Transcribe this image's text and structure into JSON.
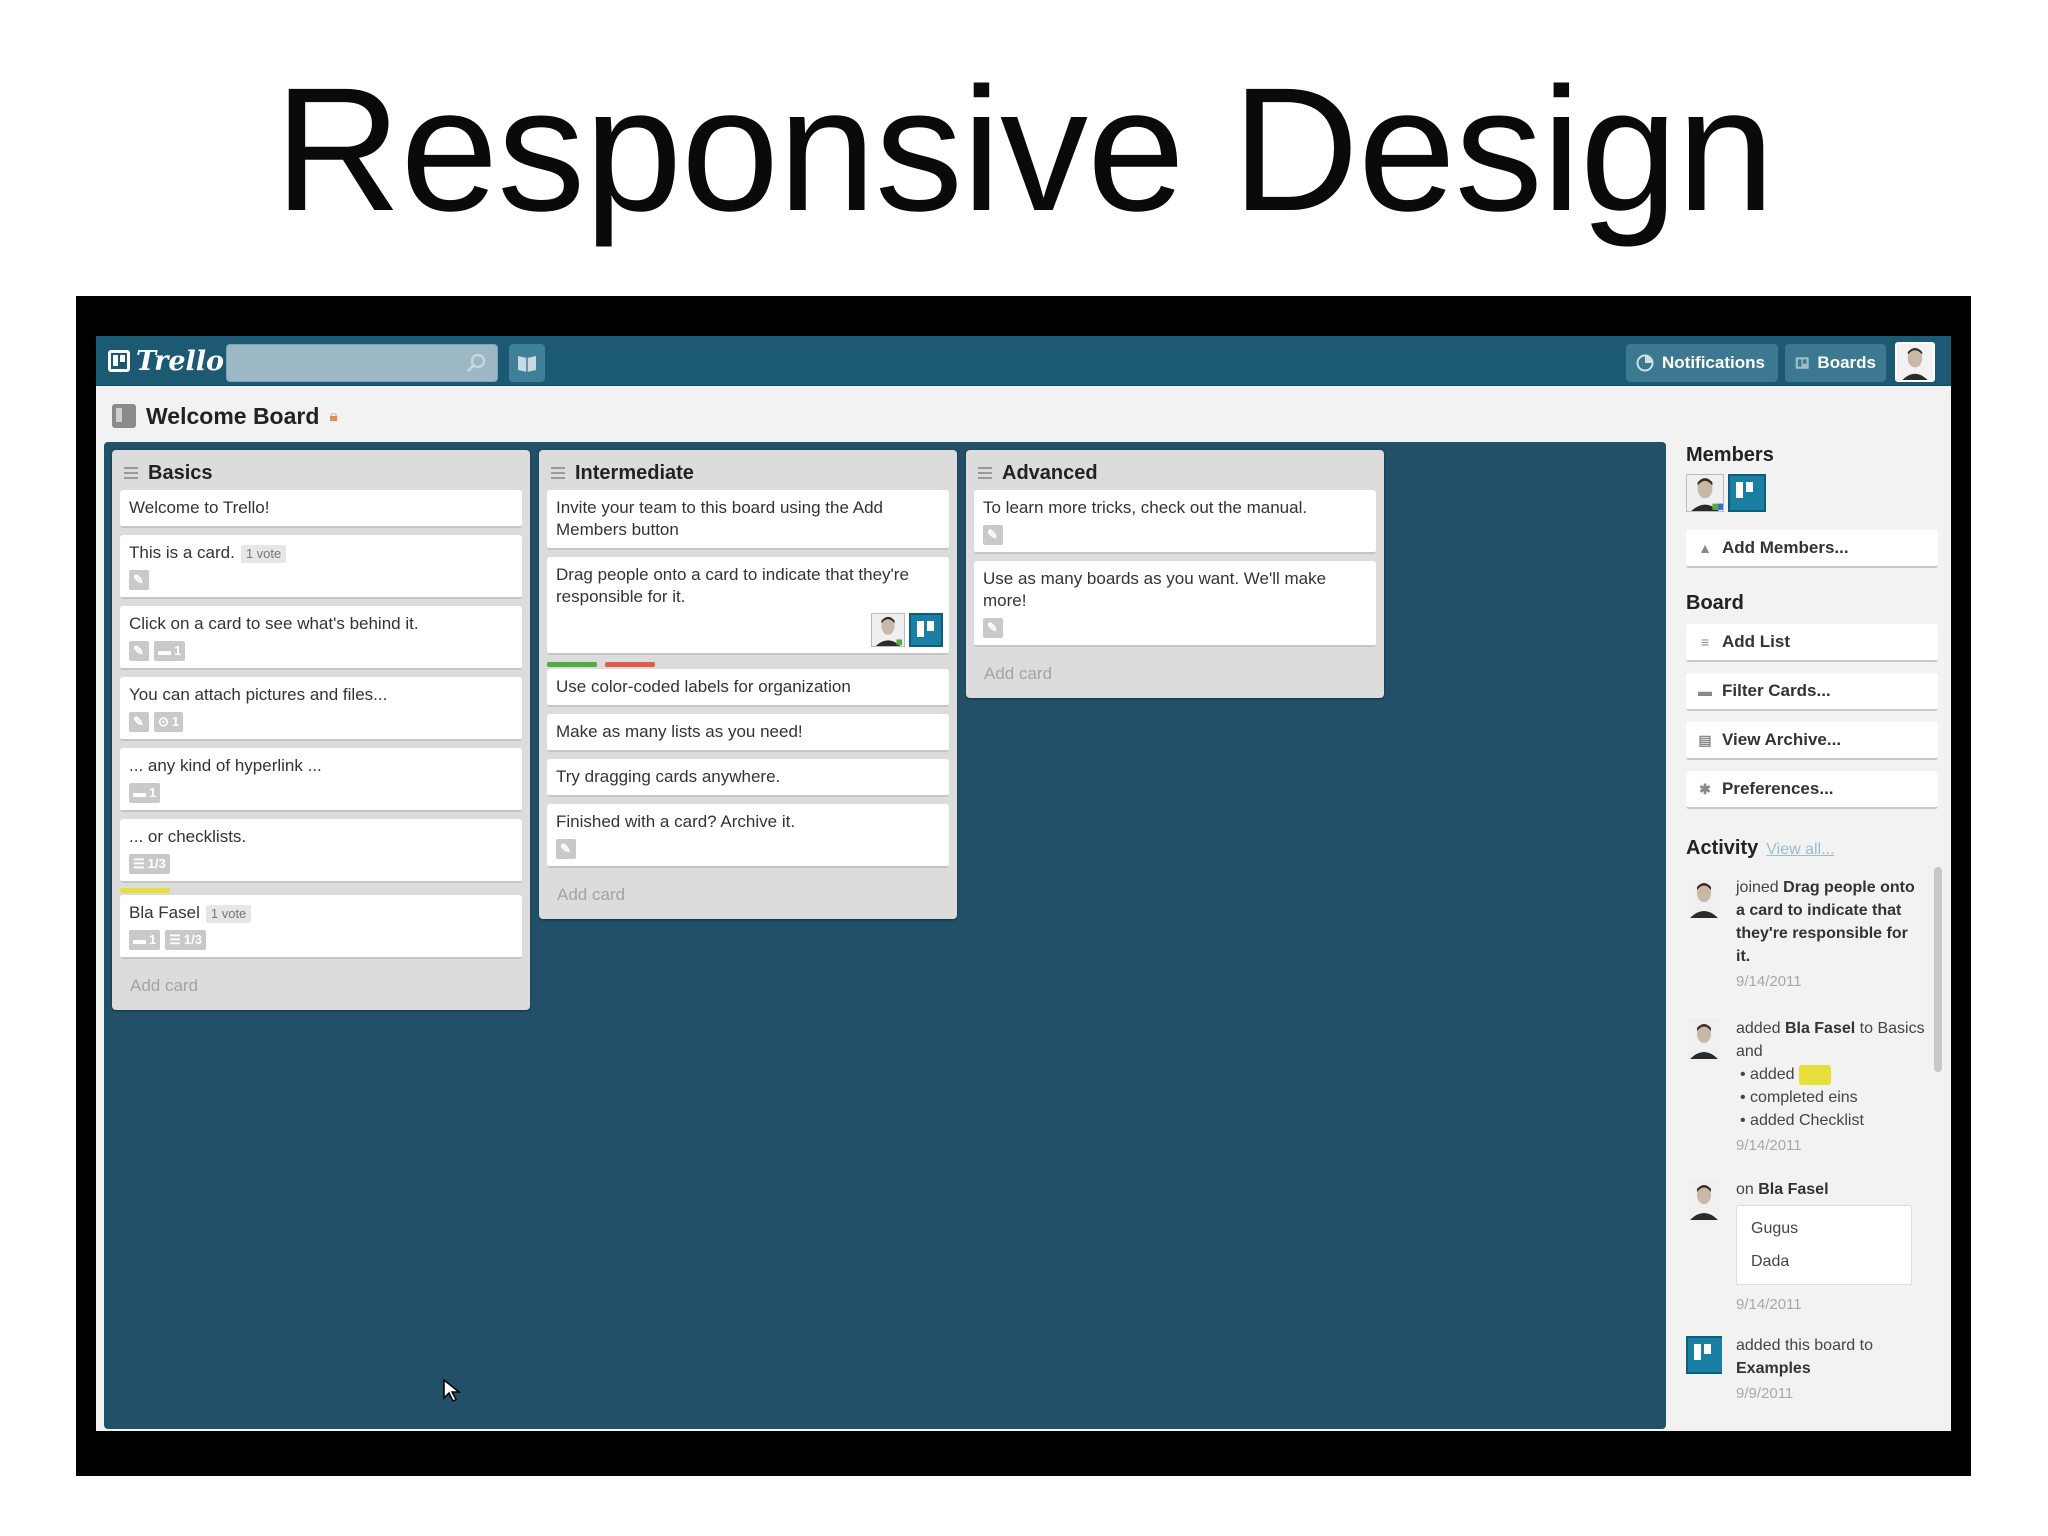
{
  "slide": {
    "title": "Responsive Design"
  },
  "app": {
    "logo_text": "Trello",
    "nav": {
      "notifications": "Notifications",
      "boards": "Boards"
    },
    "board_title": "Welcome Board",
    "accent": "#1c5a73",
    "board_bg": "#215068"
  },
  "lists": [
    {
      "title": "Basics",
      "cards": [
        {
          "text": "Welcome to Trello!"
        },
        {
          "text": "This is a card.",
          "vote": "1 vote",
          "badges": [
            "edit"
          ]
        },
        {
          "text": "Click on a card to see what's behind it.",
          "badges": [
            "edit",
            "comment:1"
          ]
        },
        {
          "text": "You can attach pictures and files...",
          "badges": [
            "edit",
            "attach:1"
          ]
        },
        {
          "text": "... any kind of hyperlink ...",
          "badges": [
            "comment:1"
          ]
        },
        {
          "text": "... or checklists.",
          "badges": [
            "check:1/3"
          ]
        },
        {
          "text": "Bla Fasel",
          "vote": "1 vote",
          "label": "yellow",
          "badges": [
            "comment:1",
            "check:1/3"
          ]
        }
      ],
      "add_card": "Add card"
    },
    {
      "title": "Intermediate",
      "cards": [
        {
          "text": "Invite your team to this board using the Add Members button"
        },
        {
          "text": "Drag people onto a card to indicate that they're responsible for it."
        },
        {
          "text": "Use color-coded labels for organization",
          "labels": [
            "green",
            "red"
          ]
        },
        {
          "text": "Make as many lists as you need!"
        },
        {
          "text": "Try dragging cards anywhere."
        },
        {
          "text": "Finished with a card? Archive it.",
          "badges": [
            "edit"
          ]
        }
      ],
      "add_card": "Add card"
    },
    {
      "title": "Advanced",
      "cards": [
        {
          "text": "To learn more tricks, check out the manual.",
          "badges": [
            "edit"
          ]
        },
        {
          "text": "Use as many boards as you want. We'll make more!",
          "badges": [
            "edit"
          ]
        }
      ],
      "add_card": "Add card"
    }
  ],
  "sidebar": {
    "members_heading": "Members",
    "add_members": "Add Members...",
    "board_heading": "Board",
    "add_list": "Add List",
    "filter_cards": "Filter Cards...",
    "view_archive": "View Archive...",
    "preferences": "Preferences...",
    "activity_heading": "Activity",
    "view_all": "View all...",
    "activity": [
      {
        "pre": "joined ",
        "bold": "Drag people onto a card to indicate that they're responsible for it.",
        "date": "9/14/2011"
      },
      {
        "pre": "added ",
        "bold": "Bla Fasel",
        "post": " to Basics and",
        "items": [
          "added",
          "completed eins",
          "added Checklist"
        ],
        "date": "9/14/2011"
      },
      {
        "pre": "on ",
        "bold": "Bla Fasel",
        "comment": [
          "Gugus",
          "Dada"
        ],
        "date": "9/14/2011"
      },
      {
        "pre": "added this board to ",
        "bold": "Examples",
        "date": "9/9/2011"
      }
    ]
  }
}
